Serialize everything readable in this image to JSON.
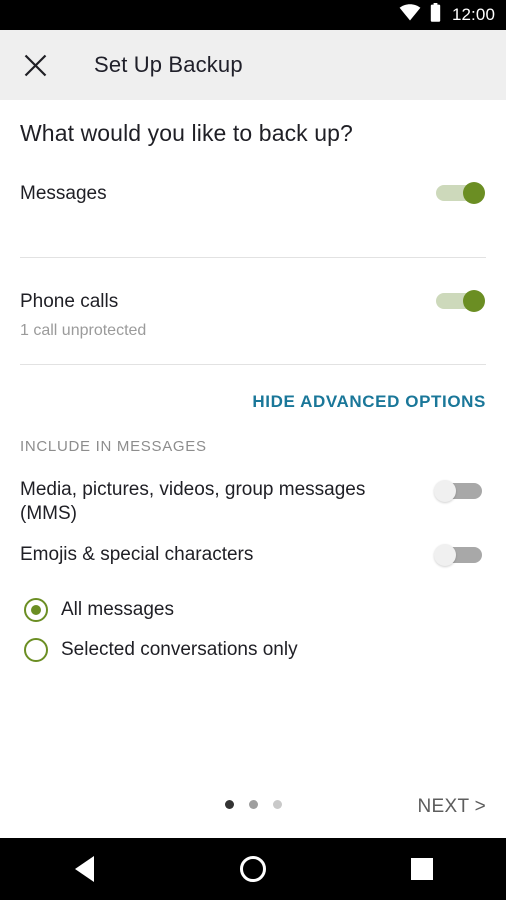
{
  "status_bar": {
    "time": "12:00",
    "wifi_icon": "wifi-icon",
    "battery_icon": "battery-icon"
  },
  "app_bar": {
    "close_icon": "close-icon",
    "title": "Set Up Backup",
    "background": "#efefef"
  },
  "content": {
    "page_title": "What would you like to back up?",
    "rows": [
      {
        "label": "Messages",
        "sublabel": "",
        "toggle_state": "on"
      },
      {
        "label": "Phone calls",
        "sublabel": "1 call unprotected",
        "toggle_state": "on"
      }
    ],
    "advanced_link": "HIDE ADVANCED OPTIONS",
    "advanced_link_color": "#1a7799",
    "section_caption": "INCLUDE IN MESSAGES",
    "advanced_rows": [
      {
        "label": "Media, pictures, videos, group messages (MMS)",
        "toggle_state": "off"
      },
      {
        "label": "Emojis & special characters",
        "toggle_state": "off"
      }
    ],
    "radio_group": {
      "selected_index": 0,
      "options": [
        {
          "label": "All messages"
        },
        {
          "label": "Selected conversations only"
        }
      ],
      "accent_color": "#6b8e23"
    }
  },
  "bottom_bar": {
    "next_label": "NEXT >",
    "page_dots": {
      "count": 3,
      "active_index": 0,
      "colors": [
        "#333333",
        "#9e9e9e",
        "#c9c9c9"
      ]
    }
  },
  "nav_bar": {
    "back_icon": "back-triangle-icon",
    "home_icon": "home-circle-icon",
    "recents_icon": "recents-square-icon"
  },
  "theme": {
    "toggle_on_thumb": "#6b8e23",
    "toggle_on_track": "#cdd9bb",
    "toggle_off_thumb": "#f0f0f0",
    "toggle_off_track": "#a8a8a8"
  }
}
